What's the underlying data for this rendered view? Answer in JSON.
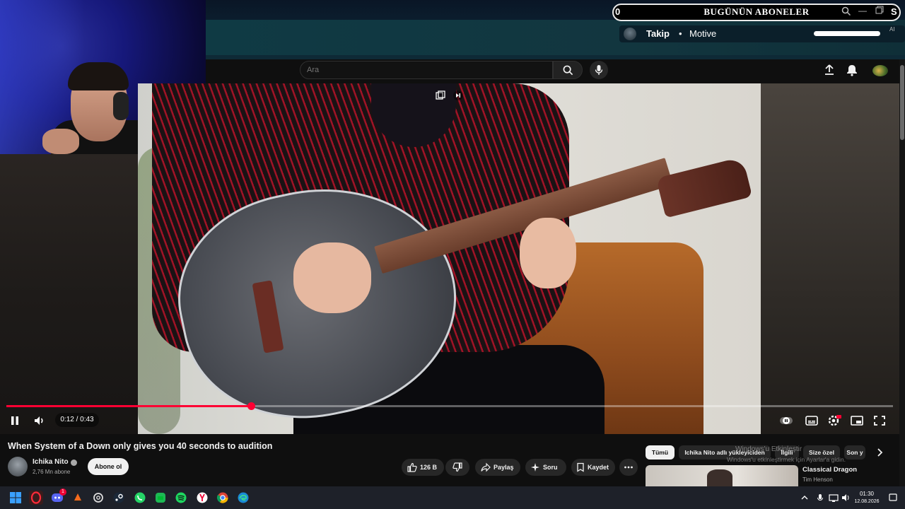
{
  "overlay": {
    "subs_count": "0",
    "subs_title": "BUGÜNÜN ABONELER",
    "subs_s": "S",
    "follow_label": "Takip",
    "follow_dot": "•",
    "follow_name": "Motive",
    "follow_ai": "AI"
  },
  "header": {
    "search_placeholder": "Ara"
  },
  "player": {
    "time_display": "0:12 / 0:43",
    "progress_fraction": 0.276
  },
  "video": {
    "title": "When System of a Down only gives you 40 seconds to audition",
    "channel_name": "Ichika Nito",
    "channel_subs": "2,76 Mn abone",
    "subscribe_label": "Abone ol",
    "like_count": "126 B",
    "share_label": "Paylaş",
    "ask_label": "Soru",
    "save_label": "Kaydet"
  },
  "sidebar": {
    "chips": [
      "Tümü",
      "Ichika Nito adlı yükleyiciden",
      "İlgili",
      "Size özel",
      "Son y"
    ],
    "reco": {
      "title": "Classical Dragon",
      "channel": "Tim Henson"
    }
  },
  "windows": {
    "activation_line1": "Windows'u Etkinleştir",
    "activation_line2": "Windows'u etkinleştirmek için Ayarlar'a gidin."
  },
  "taskbar": {
    "time": "01:30",
    "date": "12.08.2026",
    "discord_badge": "1"
  },
  "colors": {
    "accent_red": "#ff0033",
    "bg": "#0f0f0f",
    "chip": "#272727"
  },
  "icons": [
    "search-icon",
    "mic-icon",
    "upload-icon",
    "bell-icon",
    "pause-icon",
    "volume-icon",
    "captions-icon",
    "settings-icon",
    "miniplayer-icon",
    "fullscreen-icon",
    "like-icon",
    "dislike-icon",
    "share-icon",
    "sparkle-icon",
    "save-icon",
    "more-icon",
    "chevron-right-icon",
    "windows-start-icon"
  ]
}
